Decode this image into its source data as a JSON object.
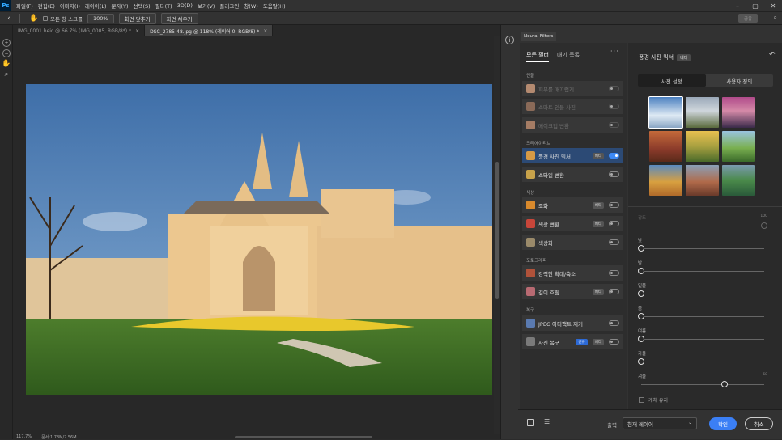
{
  "menu": [
    "파일(F)",
    "편집(E)",
    "이미지(I)",
    "레이어(L)",
    "문자(Y)",
    "선택(S)",
    "필터(T)",
    "3D(D)",
    "보기(V)",
    "플러그인",
    "창(W)",
    "도움말(H)"
  ],
  "options_bar": {
    "all_windows": "모든 창 스크롤",
    "zoom_btn": "100%",
    "fit_btn": "화면 맞추기",
    "fill_btn": "화면 채우기",
    "share": "공유"
  },
  "tabs": [
    {
      "label": "IMG_0001.heic @ 66.7% (IMG_0005, RGB/8*) *",
      "close": "×"
    },
    {
      "label": "DSC_2785-48.jpg @ 118% (레이어 0, RGB/8) *",
      "close": "×"
    }
  ],
  "status": {
    "zoom": "117.7%",
    "doc": "문서:1.78M/7.56M"
  },
  "neural": {
    "panel_tab": "Neural Filters",
    "tab_all": "모든 필터",
    "tab_wait": "대기 목록",
    "more": "···",
    "categories": {
      "portrait": "인물",
      "creative": "크리에이티브",
      "color": "색상",
      "photo": "포토그래피",
      "restore": "복구"
    },
    "filters": {
      "skin": {
        "label": "피부를 매끄럽게"
      },
      "smart": {
        "label": "스마트 인물 사진"
      },
      "makeup": {
        "label": "메이크업 변환"
      },
      "landscape": {
        "label": "풍경 사진 믹서",
        "badge": "베타"
      },
      "style": {
        "label": "스타일 변환"
      },
      "harmonize": {
        "label": "조화",
        "badge": "베타"
      },
      "colortransfer": {
        "label": "색상 변환",
        "badge": "베타"
      },
      "colorize": {
        "label": "색상화"
      },
      "superzoom": {
        "label": "강력한 확대/축소"
      },
      "depth": {
        "label": "깊이 흐림",
        "badge": "베타"
      },
      "jpeg": {
        "label": "JPEG 아티팩트 제거"
      },
      "restore": {
        "label": "사진 복구",
        "badge_new": "신규",
        "badge": "베타"
      }
    },
    "detail": {
      "title": "풍경 사진 믹서",
      "beta": "베타",
      "reset": "↶",
      "seg_presets": "사전 설정",
      "seg_custom": "사용자 정의"
    },
    "sliders": {
      "strength": {
        "name": "강도",
        "value": "100"
      },
      "day": {
        "name": "낮"
      },
      "night": {
        "name": "밤"
      },
      "sunset": {
        "name": "일몰"
      },
      "spring": {
        "name": "봄"
      },
      "summer": {
        "name": "여름"
      },
      "autumn": {
        "name": "가을"
      },
      "winter": {
        "name": "겨울",
        "value": "68"
      }
    },
    "keep_subject": "개체 유지",
    "output_label": "출력",
    "output_value": "현재 레이어",
    "ok": "확인",
    "cancel": "취소"
  }
}
